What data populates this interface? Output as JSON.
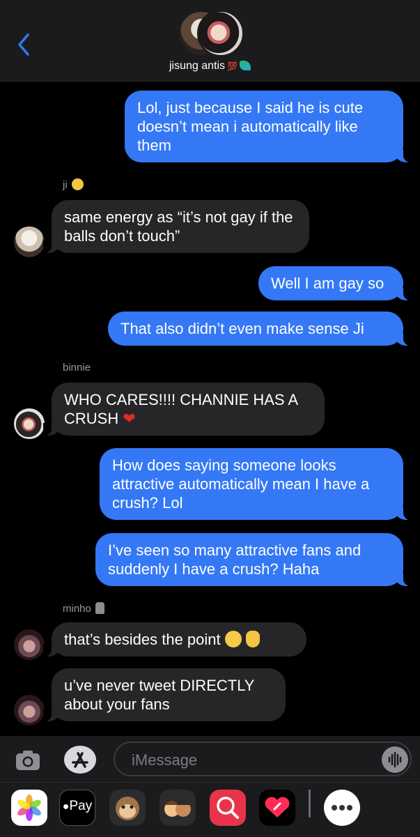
{
  "header": {
    "title": "jisung antis",
    "title_emoji_text": "💯"
  },
  "messages": [
    {
      "dir": "out",
      "text": "Lol, just because I said he is cute doesn’t mean i automatically like them"
    },
    {
      "dir": "in",
      "sender": "ji",
      "text": "same energy as “it’s not gay if the balls don’t touch”"
    },
    {
      "dir": "out",
      "text": "Well I am gay so"
    },
    {
      "dir": "out",
      "text": "That also didn’t even make sense Ji"
    },
    {
      "dir": "in",
      "sender": "binnie",
      "text": "WHO CARES!!!! CHANNIE HAS A CRUSH"
    },
    {
      "dir": "out",
      "text": "How does saying someone looks attractive automatically mean I have a crush? Lol"
    },
    {
      "dir": "out",
      "text": "I’ve seen so many attractive fans and suddenly I have a crush? Haha"
    },
    {
      "dir": "in",
      "sender": "minho",
      "text": "that’s besides the point"
    },
    {
      "dir": "in",
      "text": "u’ve never tweet DIRECTLY about your fans"
    }
  ],
  "composer": {
    "placeholder": "iMessage"
  },
  "apps": {
    "apple_pay_label": "Pay"
  },
  "icons": {
    "back": "chevron-left-icon",
    "camera": "camera-icon",
    "appstore": "app-store-icon",
    "voice": "waveform-icon",
    "more": "ellipsis-icon"
  },
  "colors": {
    "accent": "#3478f6",
    "incoming_bubble": "#262628",
    "bar": "#1b1b1d"
  }
}
